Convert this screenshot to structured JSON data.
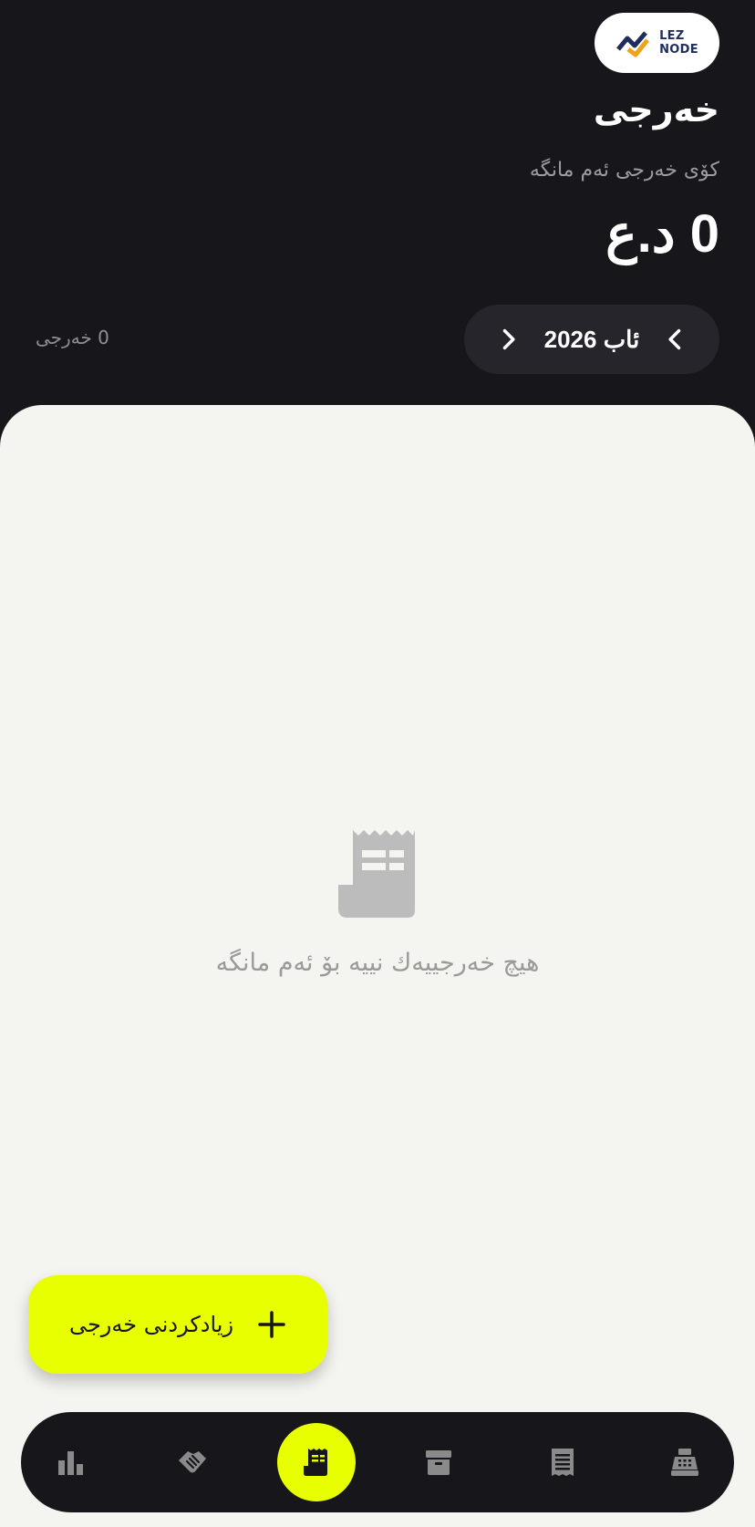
{
  "brand": {
    "logo_line1": "LEZ",
    "logo_line2": "NODE"
  },
  "header": {
    "title": "خەرجی",
    "total_label": "کۆی خەرجی ئەم مانگە",
    "total_amount": "0 د.ع",
    "month": "ئاب 2026",
    "count_text": "0 خەرجی"
  },
  "empty_state": {
    "icon": "receipt-icon",
    "message": "هیچ خەرجییەك نییە بۆ ئەم مانگە"
  },
  "fab": {
    "label": "زیادکردنی خەرجی",
    "icon": "plus-icon"
  },
  "bottom_nav": {
    "items": [
      {
        "icon": "bar-chart-icon",
        "active": false
      },
      {
        "icon": "handshake-icon",
        "active": false
      },
      {
        "icon": "receipt-icon",
        "active": true
      },
      {
        "icon": "archive-box-icon",
        "active": false
      },
      {
        "icon": "document-list-icon",
        "active": false
      },
      {
        "icon": "cash-register-icon",
        "active": false
      }
    ]
  },
  "colors": {
    "header_bg": "#17171b",
    "content_bg": "#f4f4f0",
    "accent": "#e8ff00",
    "muted_text": "#9c9ca4",
    "icon_muted": "#8a8a8a"
  }
}
